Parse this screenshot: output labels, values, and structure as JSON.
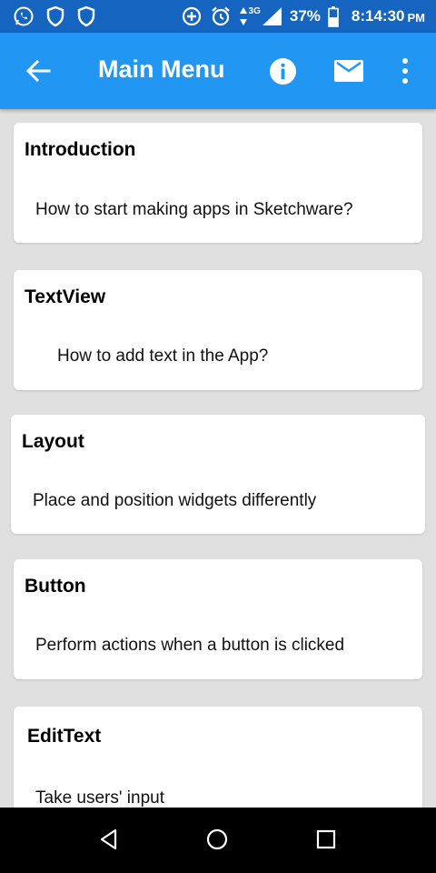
{
  "status_bar": {
    "left_icons": [
      "whatsapp-icon",
      "shield-icon",
      "shield-icon"
    ],
    "right_icons": [
      "data-saver-icon",
      "alarm-icon",
      "data-arrows-icon",
      "signal-icon",
      "battery-icon"
    ],
    "network": "3G",
    "battery": "37%",
    "time": "8:14:30",
    "ampm": "PM"
  },
  "app_bar": {
    "title": "Main Menu",
    "icons": [
      "back-arrow-icon",
      "info-icon",
      "mail-icon",
      "more-vert-icon"
    ],
    "color": "#2196f3",
    "status_color": "#1565c0"
  },
  "cards": [
    {
      "title": "Introduction",
      "subtitle": "How to start making apps in Sketchware?"
    },
    {
      "title": "TextView",
      "subtitle": "How to add text in the App?"
    },
    {
      "title": "Layout",
      "subtitle": "Place and position widgets differently"
    },
    {
      "title": "Button",
      "subtitle": "Perform actions when a button is clicked"
    },
    {
      "title": "EditText",
      "subtitle": "Take users' input"
    }
  ],
  "nav_bar": {
    "icons": [
      "back-triangle-icon",
      "home-circle-icon",
      "recents-square-icon"
    ]
  }
}
